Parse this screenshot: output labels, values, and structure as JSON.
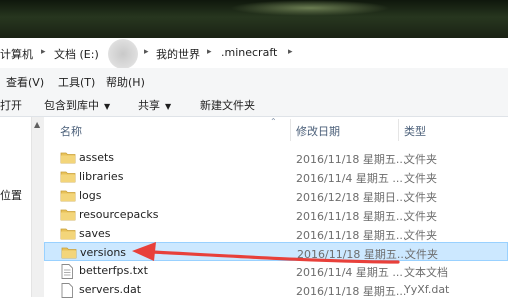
{
  "breadcrumb": {
    "items": [
      "计算机",
      "文档 (E:)",
      "我的世界",
      ".minecraft"
    ],
    "separator": "▸"
  },
  "menu": [
    "查看(V)",
    "工具(T)",
    "帮助(H)"
  ],
  "toolbar": {
    "left_partial": "打开",
    "include_in_library": "包含到库中",
    "share": "共享",
    "new_folder": "新建文件夹"
  },
  "nav": {
    "partial_label": "位置"
  },
  "columns": {
    "name": "名称",
    "modified": "修改日期",
    "type": "类型"
  },
  "files": [
    {
      "name": "assets",
      "date": "2016/11/18 星期五...",
      "type": "文件夹",
      "icon": "folder-icon"
    },
    {
      "name": "libraries",
      "date": "2016/11/4 星期五 ...",
      "type": "文件夹",
      "icon": "folder-icon"
    },
    {
      "name": "logs",
      "date": "2016/12/18 星期日...",
      "type": "文件夹",
      "icon": "folder-icon"
    },
    {
      "name": "resourcepacks",
      "date": "2016/11/18 星期五...",
      "type": "文件夹",
      "icon": "folder-icon"
    },
    {
      "name": "saves",
      "date": "2016/11/18 星期五...",
      "type": "文件夹",
      "icon": "folder-icon"
    },
    {
      "name": "versions",
      "date": "2016/11/18 星期五...",
      "type": "文件夹",
      "icon": "folder-icon",
      "selected": true
    },
    {
      "name": "betterfps.txt",
      "date": "2016/11/4 星期五 ...",
      "type": "文本文档",
      "icon": "text-file-icon"
    },
    {
      "name": "servers.dat",
      "date": "2016/11/18 星期五...",
      "type": "YyXf.dat",
      "icon": "dat-file-icon"
    }
  ],
  "colors": {
    "selection_bg": "#cce8ff",
    "selection_border": "#99d1ff",
    "header_text": "#4c607a",
    "annotation_arrow": "#e8403a",
    "folder": "#e8c25a"
  }
}
